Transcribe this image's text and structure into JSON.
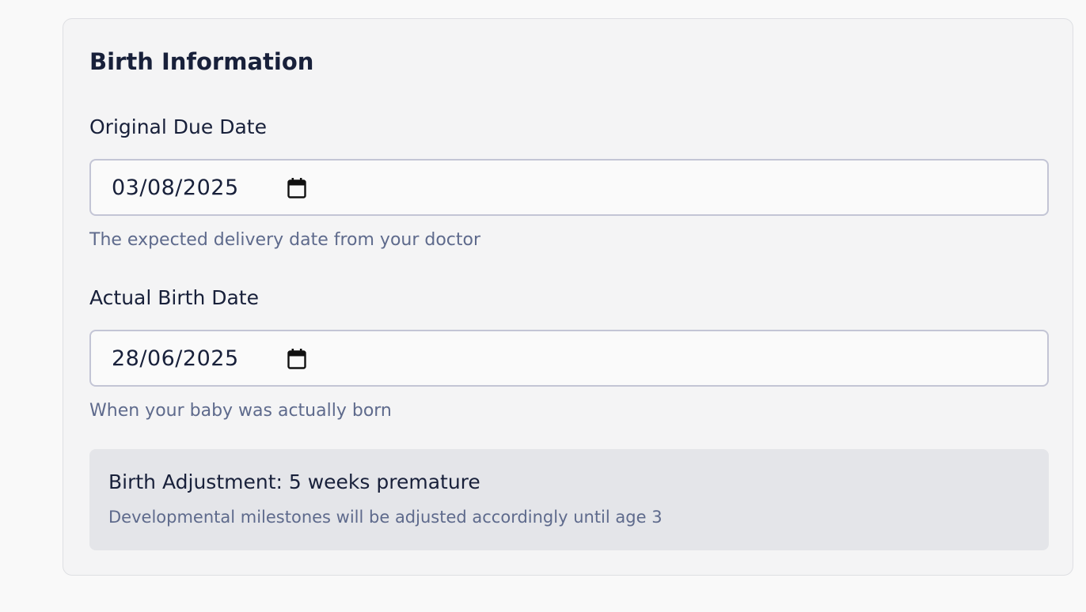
{
  "section": {
    "title": "Birth Information"
  },
  "due_date": {
    "label": "Original Due Date",
    "value": "03/08/2025",
    "hint": "The expected delivery date from your doctor",
    "icon": "calendar-icon"
  },
  "birth_date": {
    "label": "Actual Birth Date",
    "value": "28/06/2025",
    "hint": "When your baby was actually born",
    "icon": "calendar-icon"
  },
  "adjustment": {
    "title": "Birth Adjustment: 5 weeks premature",
    "note": "Developmental milestones will be adjusted accordingly until age 3"
  },
  "colors": {
    "text_primary": "#18203a",
    "text_muted": "#5e6a8c",
    "input_border": "#c3c5d5",
    "notice_background": "#e4e5e9"
  }
}
